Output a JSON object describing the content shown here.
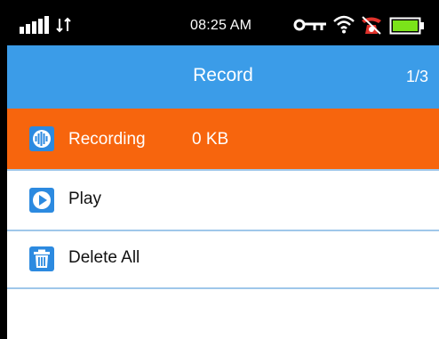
{
  "status_bar": {
    "time": "08:25 AM",
    "icons": [
      "signal-bars-icon",
      "data-arrows-icon",
      "key-icon",
      "wifi-icon",
      "alarm-icon",
      "battery-icon"
    ]
  },
  "header": {
    "title": "Record",
    "page_counter": "1/3"
  },
  "menu": {
    "items": [
      {
        "label": "Recording",
        "value": "0 KB",
        "icon": "sound-wave-icon",
        "selected": true
      },
      {
        "label": "Play",
        "icon": "play-icon",
        "selected": false
      },
      {
        "label": "Delete All",
        "icon": "trash-icon",
        "selected": false
      }
    ]
  },
  "colors": {
    "header_bg": "#3b9ce8",
    "selected_bg": "#f7650d",
    "icon_blue": "#2c8ae0",
    "divider": "#9fc7ea",
    "battery_fill": "#7be31a",
    "alarm_red": "#e0322b"
  }
}
